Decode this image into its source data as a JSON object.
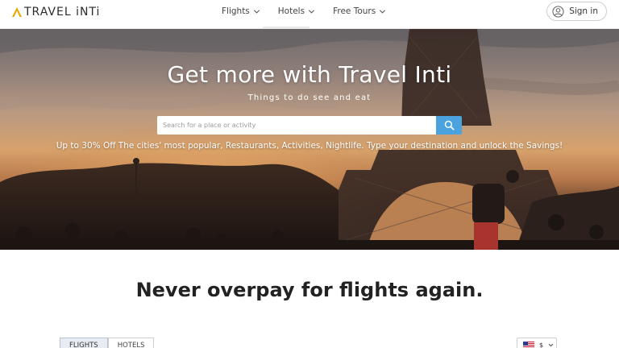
{
  "header": {
    "logo_text": "TRAVEL iNTi",
    "nav": [
      {
        "label": "Flights"
      },
      {
        "label": "Hotels"
      },
      {
        "label": "Free Tours"
      }
    ],
    "signin_label": "Sign in"
  },
  "hero": {
    "title": "Get more with Travel Inti",
    "subtitle": "Things to do see and eat",
    "search_placeholder": "Search for a place or activity",
    "promo": "Up to 30% Off The cities' most popular, Restaurants, Activities, Nightlife. Type your destination and unlock the Savings!"
  },
  "section": {
    "title": "Never overpay for flights again.",
    "tabs": [
      {
        "label": "FLIGHTS",
        "active": true
      },
      {
        "label": "HOTELS",
        "active": false
      }
    ],
    "currency_symbol": "$"
  },
  "colors": {
    "accent": "#4aa3df",
    "logo_mark": "#e6a800"
  },
  "icons": [
    "chevron-down-icon",
    "user-icon",
    "search-icon",
    "us-flag-icon"
  ]
}
